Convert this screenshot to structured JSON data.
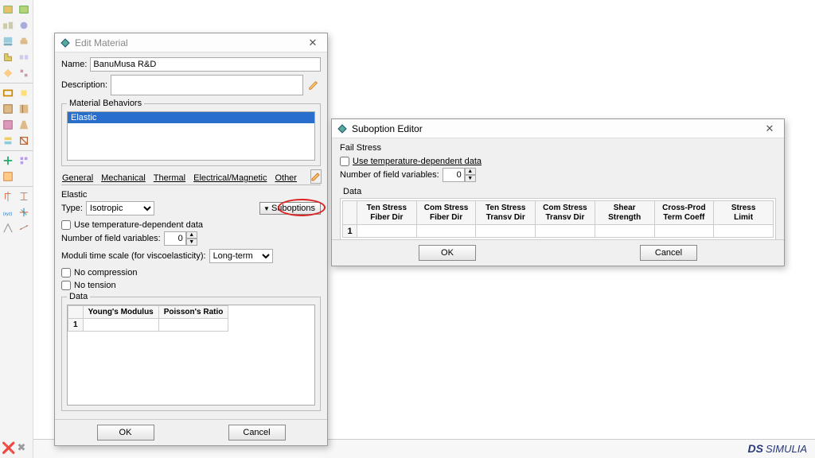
{
  "brand": {
    "prefix": "DS",
    "name": "SIMULIA"
  },
  "edit_material": {
    "title": "Edit Material",
    "name_label": "Name:",
    "name_value": "BanuMusa R&D",
    "description_label": "Description:",
    "description_value": "",
    "behaviors_legend": "Material Behaviors",
    "behaviors": [
      "Elastic"
    ],
    "tabs": [
      "General",
      "Mechanical",
      "Thermal",
      "Electrical/Magnetic",
      "Other"
    ],
    "elastic": {
      "legend": "Elastic",
      "type_label": "Type:",
      "type_value": "Isotropic",
      "suboptions_label": "Suboptions",
      "temp_dep_label": "Use temperature-dependent data",
      "temp_dep_checked": false,
      "field_vars_label": "Number of field variables:",
      "field_vars_value": "0",
      "moduli_label": "Moduli time scale (for viscoelasticity):",
      "moduli_value": "Long-term",
      "no_compression_label": "No compression",
      "no_compression_checked": false,
      "no_tension_label": "No tension",
      "no_tension_checked": false,
      "data_legend": "Data",
      "columns": [
        "Young's\nModulus",
        "Poisson's\nRatio"
      ],
      "rows": [
        [
          "",
          ""
        ]
      ]
    },
    "ok": "OK",
    "cancel": "Cancel"
  },
  "suboption_editor": {
    "title": "Suboption Editor",
    "section": "Fail Stress",
    "temp_dep_label": "Use temperature-dependent data",
    "temp_dep_checked": false,
    "field_vars_label": "Number of field variables:",
    "field_vars_value": "0",
    "data_legend": "Data",
    "columns": [
      "Ten Stress\nFiber Dir",
      "Com Stress\nFiber Dir",
      "Ten Stress\nTransv Dir",
      "Com Stress\nTransv Dir",
      "Shear\nStrength",
      "Cross-Prod\nTerm Coeff",
      "Stress\nLimit"
    ],
    "rows": [
      [
        "",
        "",
        "",
        "",
        "",
        "",
        ""
      ]
    ],
    "ok": "OK",
    "cancel": "Cancel"
  }
}
